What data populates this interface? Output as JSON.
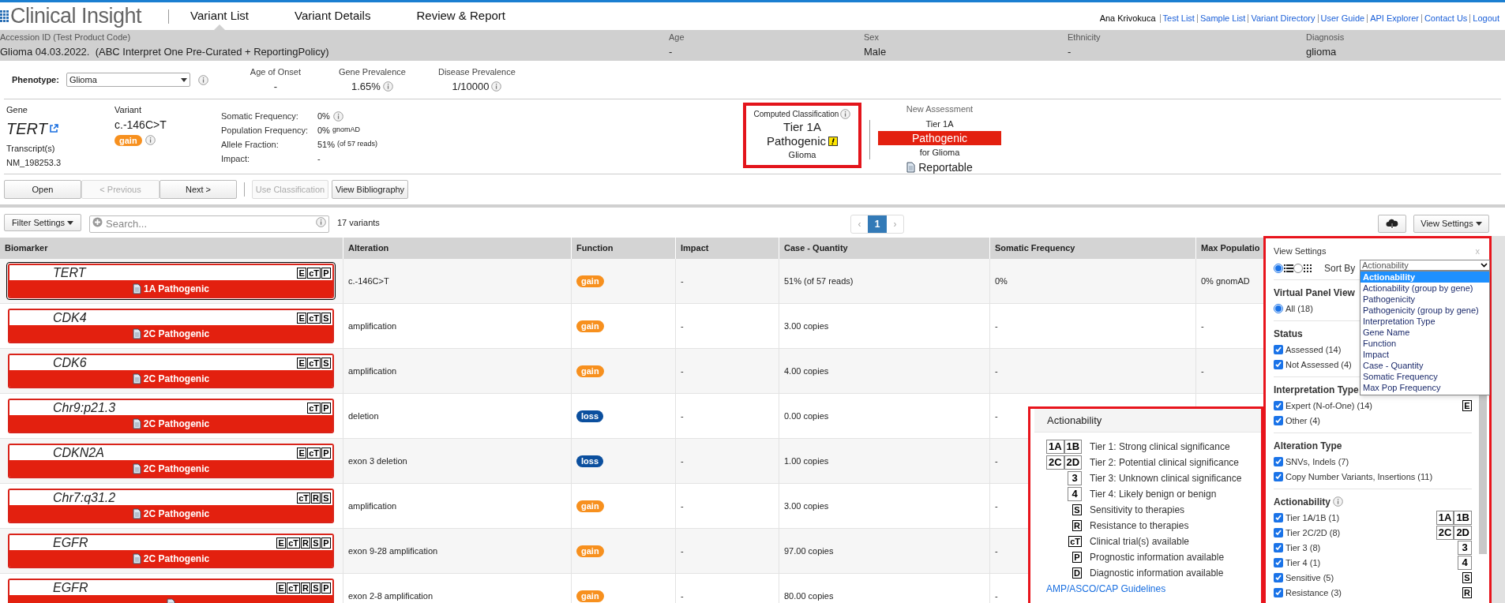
{
  "app": {
    "logo": "Clinical Insight",
    "tabs": [
      {
        "label": "Variant List",
        "selected": true
      },
      {
        "label": "Variant Details",
        "selected": false
      },
      {
        "label": "Review & Report",
        "selected": false
      }
    ],
    "user": "Ana Krivokuca",
    "links": [
      "Test List",
      "Sample List",
      "Variant Directory",
      "User Guide",
      "API Explorer",
      "Contact Us",
      "Logout"
    ]
  },
  "patient": {
    "accession_label": "Accession ID (Test Product Code)",
    "accession": "Glioma 04.03.2022.  (ABC Interpret One Pre-Curated + ReportingPolicy)",
    "fields": [
      {
        "label": "Age",
        "value": "-"
      },
      {
        "label": "Sex",
        "value": "Male"
      },
      {
        "label": "Ethnicity",
        "value": "-"
      },
      {
        "label": "Diagnosis",
        "value": "glioma"
      }
    ]
  },
  "phenotype": {
    "label": "Phenotype:",
    "value": "Glioma",
    "stats": [
      {
        "label": "Age of Onset",
        "value": "-"
      },
      {
        "label": "Gene Prevalence",
        "value": "1.65%",
        "info": true
      },
      {
        "label": "Disease Prevalence",
        "value": "1/10000",
        "info": true
      }
    ]
  },
  "variant": {
    "gene_label": "Gene",
    "gene": "TERT",
    "transcript_label": "Transcript(s)",
    "transcript": "NM_198253.3",
    "variant_label": "Variant",
    "variant": "c.-146C>T",
    "function": {
      "label": "gain",
      "color": "#f7901e"
    },
    "details": [
      {
        "label": "Somatic Frequency:",
        "value": "0%",
        "info": true
      },
      {
        "label": "Population Frequency:",
        "value": "0%",
        "note": "gnomAD"
      },
      {
        "label": "Allele Fraction:",
        "value": "51%",
        "note": "(of 57 reads)"
      },
      {
        "label": "Impact:",
        "value": "-"
      }
    ],
    "computed": {
      "title": "Computed Classification",
      "tier": "Tier 1A",
      "classification": "Pathogenic",
      "warning": true,
      "disease": "Glioma"
    },
    "assessment": {
      "title": "New Assessment",
      "tier": "Tier 1A",
      "classification": "Pathogenic",
      "disease": "for Glioma",
      "report": "Reportable"
    }
  },
  "actions": [
    {
      "label": "Open",
      "disabled": false
    },
    {
      "label": "< Previous",
      "disabled": true
    },
    {
      "label": "Next >",
      "disabled": false
    },
    {
      "label": "Use Classification",
      "disabled": true
    },
    {
      "label": "View Bibliography",
      "disabled": false
    }
  ],
  "toolbar": {
    "filter": "Filter Settings",
    "search_placeholder": "Search...",
    "count": "17 variants",
    "prev": "‹",
    "next": "›",
    "pages": [
      {
        "label": "1",
        "selected": true
      }
    ],
    "view_settings": "View Settings"
  },
  "table": {
    "columns": [
      "Biomarker",
      "Alteration",
      "Function",
      "Impact",
      "Case - Quantity",
      "Somatic Frequency",
      "Max Populatio"
    ],
    "rows": [
      {
        "biomarker": "TERT",
        "tags": [
          "E",
          "cT",
          "P"
        ],
        "classification": "1A Pathogenic",
        "selected": true,
        "alteration": "c.-146C>T",
        "function": {
          "label": "gain",
          "color": "#f7901e"
        },
        "impact": "-",
        "case_quantity": "51% (of 57 reads)",
        "somatic": "0%",
        "max_pop": "0% gnomAD"
      },
      {
        "biomarker": "CDK4",
        "tags": [
          "E",
          "cT",
          "S"
        ],
        "classification": "2C Pathogenic",
        "selected": false,
        "alteration": "amplification",
        "function": {
          "label": "gain",
          "color": "#f7901e"
        },
        "impact": "-",
        "case_quantity": "3.00 copies",
        "somatic": "-",
        "max_pop": "-"
      },
      {
        "biomarker": "CDK6",
        "tags": [
          "E",
          "cT",
          "S"
        ],
        "classification": "2C Pathogenic",
        "selected": false,
        "alteration": "amplification",
        "function": {
          "label": "gain",
          "color": "#f7901e"
        },
        "impact": "-",
        "case_quantity": "4.00 copies",
        "somatic": "-",
        "max_pop": "-"
      },
      {
        "biomarker": "Chr9:p21.3",
        "tags": [
          "cT",
          "P"
        ],
        "classification": "2C Pathogenic",
        "selected": false,
        "alteration": "deletion",
        "function": {
          "label": "loss",
          "color": "#0b4f9e"
        },
        "impact": "-",
        "case_quantity": "0.00 copies",
        "somatic": "-"
      },
      {
        "biomarker": "CDKN2A",
        "tags": [
          "E",
          "cT",
          "P"
        ],
        "classification": "2C Pathogenic",
        "selected": false,
        "alteration": "exon 3 deletion",
        "function": {
          "label": "loss",
          "color": "#0b4f9e"
        },
        "impact": "-",
        "case_quantity": "1.00 copies",
        "somatic": "-"
      },
      {
        "biomarker": "Chr7:q31.2",
        "tags": [
          "cT",
          "R",
          "S"
        ],
        "classification": "2C Pathogenic",
        "selected": false,
        "alteration": "amplification",
        "function": {
          "label": "gain",
          "color": "#f7901e"
        },
        "impact": "-",
        "case_quantity": "3.00 copies",
        "somatic": "-"
      },
      {
        "biomarker": "EGFR",
        "tags": [
          "E",
          "cT",
          "R",
          "S",
          "P"
        ],
        "classification": "2C Pathogenic",
        "selected": false,
        "alteration": "exon 9-28 amplification",
        "function": {
          "label": "gain",
          "color": "#f7901e"
        },
        "impact": "-",
        "case_quantity": "97.00 copies",
        "somatic": "-"
      },
      {
        "biomarker": "EGFR",
        "tags": [
          "E",
          "cT",
          "R",
          "S",
          "P"
        ],
        "selected": false,
        "alteration": "exon 2-8 amplification",
        "function": {
          "label": "gain",
          "color": "#f7901e"
        },
        "impact": "-",
        "case_quantity": "80.00 copies",
        "somatic": "-"
      }
    ]
  },
  "legend": {
    "title": "Actionability",
    "items": [
      {
        "badges": [
          {
            "label": "1A",
            "kind": "tier"
          },
          {
            "label": "1B",
            "kind": "tier"
          }
        ],
        "text": "Tier 1: Strong clinical significance"
      },
      {
        "badges": [
          {
            "label": "2C",
            "kind": "tier"
          },
          {
            "label": "2D",
            "kind": "tier"
          }
        ],
        "text": "Tier 2: Potential clinical significance"
      },
      {
        "badges": [
          {
            "label": "3",
            "kind": "tier"
          }
        ],
        "text": "Tier 3: Unknown clinical significance"
      },
      {
        "badges": [
          {
            "label": "4",
            "kind": "tier"
          }
        ],
        "text": "Tier 4: Likely benign or benign"
      },
      {
        "badges": [
          {
            "label": "S",
            "kind": "letter"
          }
        ],
        "text": "Sensitivity to therapies"
      },
      {
        "badges": [
          {
            "label": "R",
            "kind": "letter"
          }
        ],
        "text": "Resistance to therapies"
      },
      {
        "badges": [
          {
            "label": "cT",
            "kind": "letter"
          }
        ],
        "text": "Clinical trial(s) available"
      },
      {
        "badges": [
          {
            "label": "P",
            "kind": "letter"
          }
        ],
        "text": "Prognostic information available"
      },
      {
        "badges": [
          {
            "label": "D",
            "kind": "letter"
          }
        ],
        "text": "Diagnostic information available"
      }
    ],
    "link": "AMP/ASCO/CAP Guidelines"
  },
  "view_settings": {
    "title": "View Settings",
    "close": "x",
    "layouts": [
      {
        "kind": "list",
        "selected": true
      },
      {
        "kind": "grid",
        "selected": false
      }
    ],
    "sort_label": "Sort By",
    "sort_value": "Actionability",
    "sort_options": [
      {
        "label": "Actionability",
        "selected": true
      },
      {
        "label": "Actionability (group by gene)",
        "selected": false
      },
      {
        "label": "Pathogenicity",
        "selected": false
      },
      {
        "label": "Pathogenicity (group by gene)",
        "selected": false
      },
      {
        "label": "Interpretation Type",
        "selected": false
      },
      {
        "label": "Gene Name",
        "selected": false
      },
      {
        "label": "Function",
        "selected": false
      },
      {
        "label": "Impact",
        "selected": false
      },
      {
        "label": "Case - Quantity",
        "selected": false
      },
      {
        "label": "Somatic Frequency",
        "selected": false
      },
      {
        "label": "Max Pop Frequency",
        "selected": false
      }
    ],
    "sections": [
      {
        "title": "Virtual Panel View",
        "items": [
          {
            "kind": "radio",
            "label": "All (18)",
            "checked": true
          }
        ]
      },
      {
        "title": "Status",
        "items": [
          {
            "kind": "checkbox",
            "label": "Assessed (14)",
            "checked": true
          },
          {
            "kind": "checkbox",
            "label": "Not Assessed (4)",
            "checked": true
          }
        ]
      },
      {
        "title": "Interpretation Type",
        "items": [
          {
            "kind": "checkbox",
            "label": "Expert (N-of-One) (14)",
            "checked": true,
            "badges": [
              {
                "label": "E",
                "kind": "letter"
              }
            ]
          },
          {
            "kind": "checkbox",
            "label": "Other (4)",
            "checked": true
          }
        ]
      },
      {
        "title": "Alteration Type",
        "items": [
          {
            "kind": "checkbox",
            "label": "SNVs, Indels (7)",
            "checked": true
          },
          {
            "kind": "checkbox",
            "label": "Copy Number Variants, Insertions (11)",
            "checked": true
          }
        ]
      },
      {
        "title": "Actionability",
        "info": true,
        "items": [
          {
            "kind": "checkbox",
            "label": "Tier 1A/1B (1)",
            "checked": true,
            "badges": [
              {
                "label": "1A",
                "kind": "tier"
              },
              {
                "label": "1B",
                "kind": "tier"
              }
            ]
          },
          {
            "kind": "checkbox",
            "label": "Tier 2C/2D (8)",
            "checked": true,
            "badges": [
              {
                "label": "2C",
                "kind": "tier"
              },
              {
                "label": "2D",
                "kind": "tier"
              }
            ]
          },
          {
            "kind": "checkbox",
            "label": "Tier 3 (8)",
            "checked": true,
            "badges": [
              {
                "label": "3",
                "kind": "tier"
              }
            ]
          },
          {
            "kind": "checkbox",
            "label": "Tier 4 (1)",
            "checked": true,
            "badges": [
              {
                "label": "4",
                "kind": "tier"
              }
            ]
          },
          {
            "kind": "checkbox",
            "label": "Sensitive (5)",
            "checked": true,
            "badges": [
              {
                "label": "S",
                "kind": "letter"
              }
            ]
          },
          {
            "kind": "checkbox",
            "label": "Resistance (3)",
            "checked": true,
            "badges": [
              {
                "label": "R",
                "kind": "letter"
              }
            ]
          }
        ]
      }
    ]
  }
}
